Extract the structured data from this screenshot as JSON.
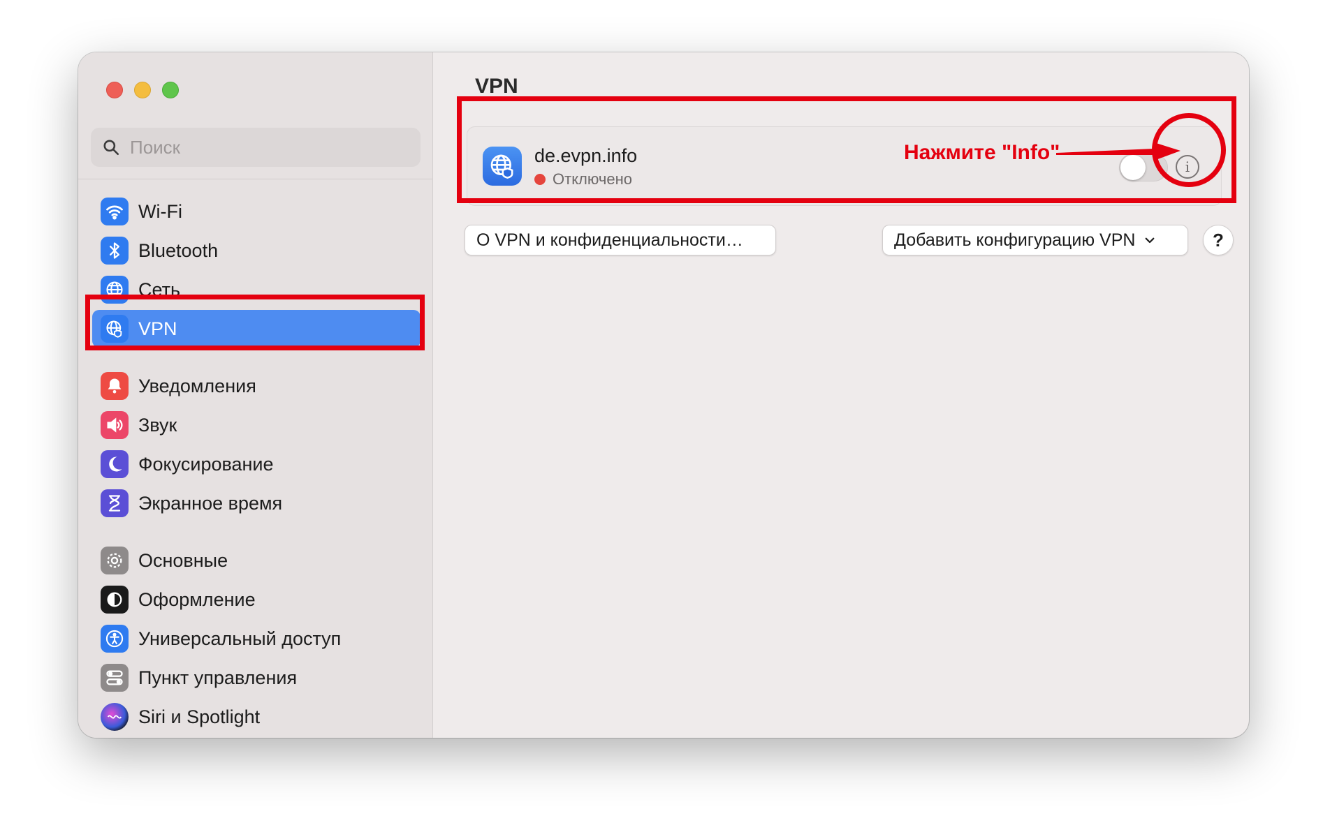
{
  "window": {
    "traffic_lights": [
      "close",
      "minimize",
      "maximize"
    ]
  },
  "search": {
    "placeholder": "Поиск",
    "icon": "search-icon"
  },
  "sidebar": {
    "items": [
      {
        "label": "Wi-Fi",
        "icon": "wifi-icon",
        "color": "#2f7bf0"
      },
      {
        "label": "Bluetooth",
        "icon": "bluetooth-icon",
        "color": "#2f7bf0"
      },
      {
        "label": "Сеть",
        "icon": "globe-icon",
        "color": "#2f7bf0"
      },
      {
        "label": "VPN",
        "icon": "vpn-globe-icon",
        "color": "#2f7bf0",
        "active": true
      },
      {
        "label": "Уведомления",
        "icon": "bell-icon",
        "color": "#ee4b43"
      },
      {
        "label": "Звук",
        "icon": "speaker-icon",
        "color": "#ec4668"
      },
      {
        "label": "Фокусирование",
        "icon": "moon-icon",
        "color": "#5b4fd6"
      },
      {
        "label": "Экранное время",
        "icon": "hourglass-icon",
        "color": "#5b4fd6"
      },
      {
        "label": "Основные",
        "icon": "gear-icon",
        "color": "#8e8a8a"
      },
      {
        "label": "Оформление",
        "icon": "appearance-icon",
        "color": "#1a1a1a"
      },
      {
        "label": "Универсальный доступ",
        "icon": "accessibility-icon",
        "color": "#2f7bf0"
      },
      {
        "label": "Пункт управления",
        "icon": "control-center-icon",
        "color": "#8e8a8a"
      },
      {
        "label": "Siri и Spotlight",
        "icon": "siri-icon",
        "color": "#6c2bd9"
      }
    ]
  },
  "main": {
    "title": "VPN",
    "vpn": {
      "name": "de.evpn.info",
      "status": "Отключено",
      "status_color": "#e5453d",
      "enabled": false
    },
    "buttons": {
      "about": "О VPN и конфиденциальности…",
      "add": "Добавить конфигурацию VPN",
      "help": "?"
    }
  },
  "annotation": {
    "text": "Нажмите \"Info\"",
    "color": "#e4000f"
  }
}
